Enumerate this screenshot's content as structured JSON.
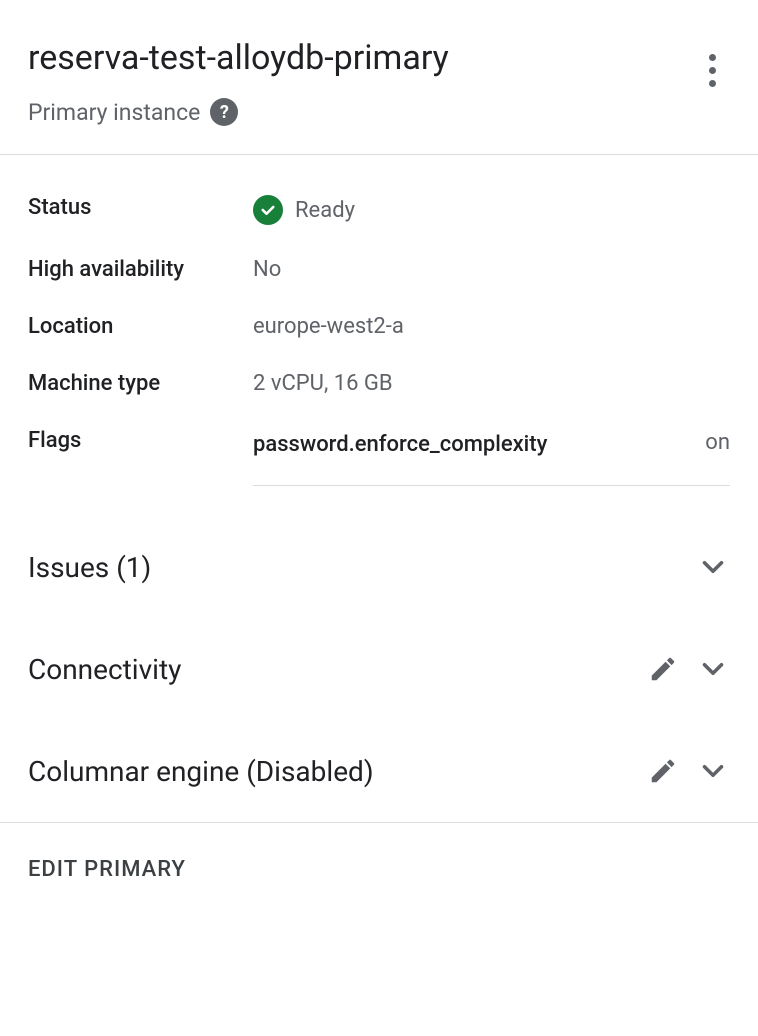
{
  "header": {
    "title": "reserva-test-alloydb-primary",
    "subtitle": "Primary instance"
  },
  "details": {
    "status_label": "Status",
    "status_value": "Ready",
    "ha_label": "High availability",
    "ha_value": "No",
    "location_label": "Location",
    "location_value": "europe-west2-a",
    "machine_label": "Machine type",
    "machine_value": "2 vCPU, 16 GB",
    "flags_label": "Flags",
    "flag_name": "password.enforce_complexity",
    "flag_value": "on"
  },
  "sections": {
    "issues": "Issues (1)",
    "connectivity": "Connectivity",
    "columnar": "Columnar engine (Disabled)"
  },
  "footer": {
    "edit": "EDIT PRIMARY"
  }
}
